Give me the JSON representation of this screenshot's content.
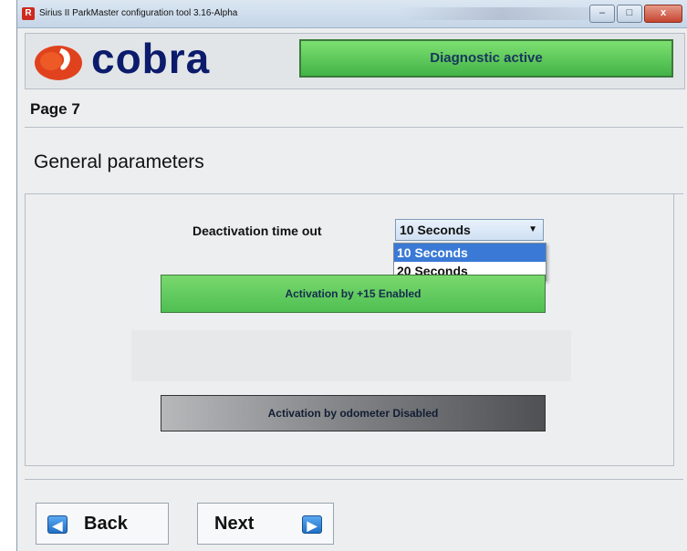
{
  "window": {
    "title": "Sirius II ParkMaster configuration tool  3.16-Alpha",
    "app_icon_letter": "R",
    "controls": {
      "minimize": "–",
      "maximize": "□",
      "close": "x"
    }
  },
  "header": {
    "logo_text": "cobra",
    "status": "Diagnostic active",
    "status_color": "#4fbf52"
  },
  "page": {
    "label": "Page 7",
    "section_title": "General parameters"
  },
  "deactivation": {
    "label": "Deactivation time out",
    "selected": "10 Seconds",
    "options": [
      "10 Seconds",
      "20 Seconds"
    ]
  },
  "buttons": {
    "activation_15": "Activation by +15 Enabled",
    "activation_odometer": "Activation by odometer Disabled",
    "back": "Back",
    "next": "Next"
  },
  "icons": {
    "back": "arrow-left-icon",
    "next": "arrow-right-icon",
    "dropdown": "chevron-down-icon"
  }
}
